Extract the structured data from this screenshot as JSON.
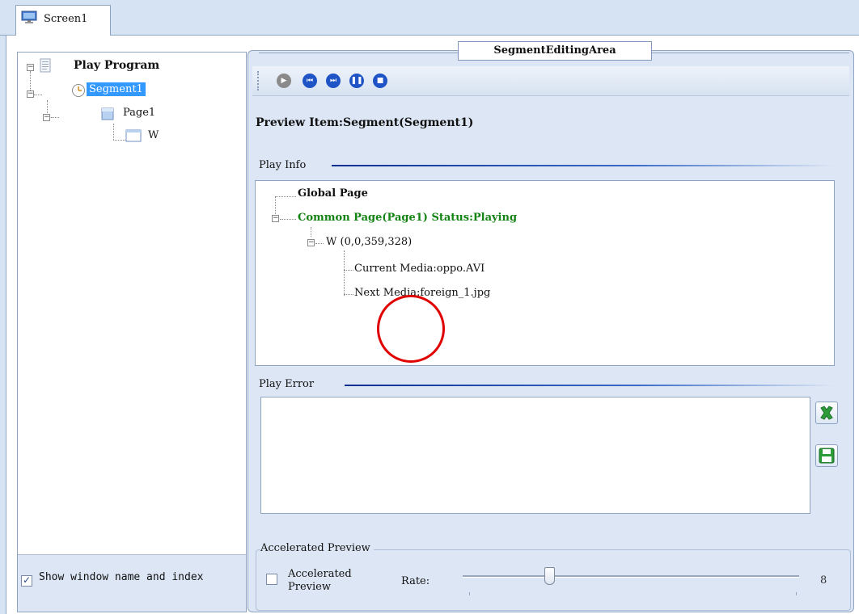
{
  "tab": {
    "label": "Screen1",
    "icon": "monitor-icon"
  },
  "tree": {
    "root": "Play Program",
    "segment": "Segment1",
    "page": "Page1",
    "window": "W"
  },
  "left_footer": {
    "show_window_label": "Show window name and index",
    "checked": true
  },
  "segment_area": {
    "title": "SegmentEditingArea",
    "toolbar": [
      "play-icon",
      "previous-icon",
      "next-icon",
      "pause-icon",
      "stop-icon"
    ],
    "preview_item": "Preview Item:Segment(Segment1)"
  },
  "play_info": {
    "label": "Play Info",
    "global_page": "Global Page",
    "common_page": "Common Page(Page1) Status:Playing",
    "window_node": "W  (0,0,359,328)",
    "current_media": "Current Media:oppo.AVI",
    "next_media": "Next Media:foreign_1.jpg"
  },
  "play_error": {
    "label": "Play Error",
    "clear_icon": "clear-icon",
    "save_icon": "save-icon"
  },
  "accelerated": {
    "group_label": "Accelerated Preview",
    "checkbox_label": "Accelerated Preview",
    "checked": false,
    "rate_label": "Rate:",
    "rate_value": "8"
  },
  "colors": {
    "selection": "#3399ff",
    "status_green": "#128212",
    "toolbar_blue": "#1f54c6",
    "highlight_circle": "#e00000"
  }
}
